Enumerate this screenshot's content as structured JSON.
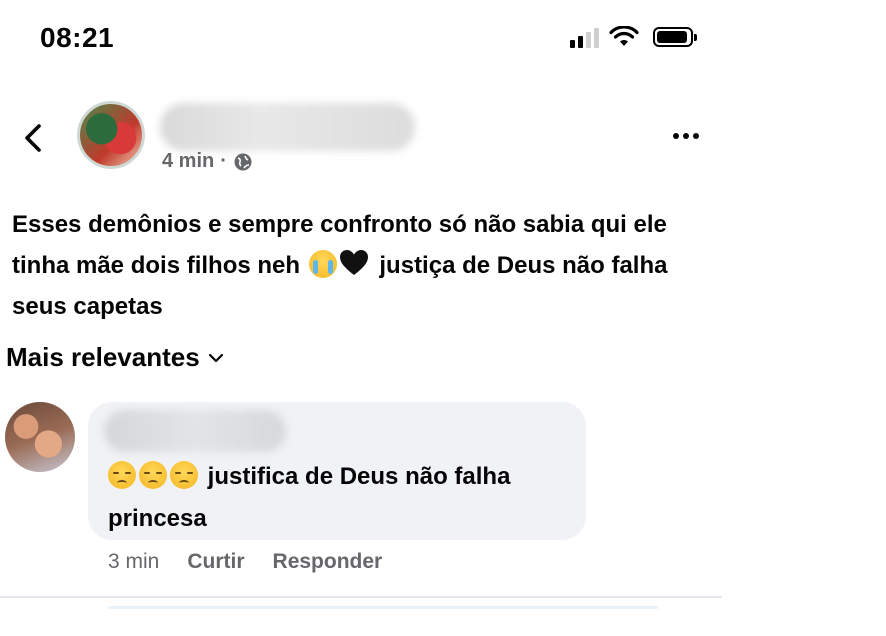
{
  "status_bar": {
    "time": "08:21",
    "icons": [
      "signal-icon",
      "wifi-icon",
      "battery-icon"
    ]
  },
  "header": {
    "back_icon": "chevron-left-icon",
    "more_icon": "more-horizontal-icon"
  },
  "post": {
    "time": "4 min",
    "separator": "·",
    "privacy_icon": "globe-icon",
    "text_part1": "Esses demônios e sempre confronto só não sabia qui ele tinha mãe dois filhos neh",
    "emojis": [
      "crying-face-emoji",
      "black-heart-emoji"
    ],
    "text_part2": "justiça de Deus não falha seus capetas"
  },
  "comments_sort": {
    "label": "Mais relevantes",
    "icon": "chevron-down-icon"
  },
  "comment": {
    "emojis": [
      "disappointed-face-emoji",
      "disappointed-face-emoji",
      "disappointed-face-emoji"
    ],
    "text": "justifica de Deus não falha princesa",
    "time": "3 min",
    "like_label": "Curtir",
    "reply_label": "Responder"
  },
  "colors": {
    "text_primary": "#050505",
    "text_secondary": "#65676b",
    "bubble_bg": "#f0f2f5"
  }
}
